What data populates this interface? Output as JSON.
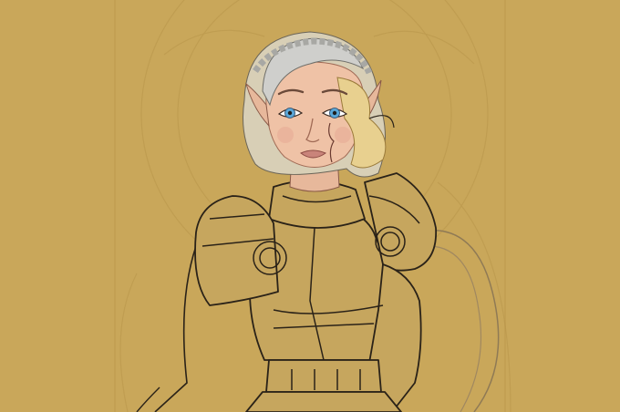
{
  "artwork": {
    "subject": "elf-woman-armor-sketch",
    "colors": {
      "background": "#c9a75a",
      "line": "#2a2218",
      "skin": "#efc2a6",
      "hair": "#c9c9c6",
      "hair_blonde": "#e8d08f",
      "eye": "#5aa7d8",
      "lips": "#c9847a",
      "armor_fill": "#c6a65e"
    }
  }
}
